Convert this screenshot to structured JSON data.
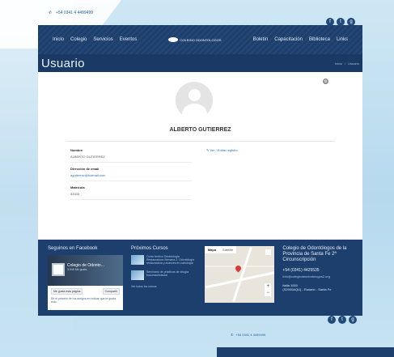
{
  "topbar": {
    "phone_text": "+54 0341 4 4499499"
  },
  "social": {
    "icons": [
      "facebook-icon",
      "twitter-icon",
      "googleplus-icon"
    ]
  },
  "nav": {
    "left": [
      "Inicio",
      "Colegio",
      "Servicios",
      "Eventos"
    ],
    "logo_text": "COLEGIO ODONTOLOGOS",
    "right": [
      "Boletín",
      "Capacitación",
      "Biblioteca",
      "Links"
    ]
  },
  "page": {
    "title": "Usuario",
    "breadcrumb": [
      "Inicio",
      "Usuario"
    ]
  },
  "profile": {
    "name": "ALBERTO GUTIERREZ",
    "edit_link": "Ver / Editar registro",
    "fields": [
      {
        "label": "Nombre",
        "value": "ALBERTO GUTIERREZ",
        "is_link": false
      },
      {
        "label": "Dirección de email",
        "value": "agutierrez@hotmail.com",
        "is_link": true
      },
      {
        "label": "Matrícula",
        "value": "33333",
        "is_link": false
      }
    ]
  },
  "footer": {
    "facebook": {
      "heading": "Seguinos en Facebook",
      "page_name": "Colegio de Odonto...",
      "page_sub": "3.945 Me gusta",
      "like_label": "Me gusta esta página",
      "share_label": "Compartir",
      "note": "Sé el primero de tus amigos en indicar que te gusta esto."
    },
    "courses": {
      "heading": "Próximos Cursos",
      "items": [
        "Curso teórico Odontología Restauradora Semana 2, Odontología restauradora y avances en cariología",
        "Seminario de prácticas de cirugía bucomaxilofacial"
      ],
      "more_label": "Ver todos los cursos"
    },
    "map": {
      "tab_map": "Mapa",
      "tab_sat": "Satélite"
    },
    "contact": {
      "org": "Colegio de Odontólogos de la Provincia de Santa Fe 2ª Circunscripción",
      "phone": "+54 (0341) 4425535",
      "email": "info@colegiodeodontologos2.org",
      "address_1": "Italia 1000",
      "address_2": "(S2000AQU) - Rosario - Santa Fe"
    }
  },
  "bottom_topbar": {
    "phone_text": "+54 0341 4 4499499"
  }
}
